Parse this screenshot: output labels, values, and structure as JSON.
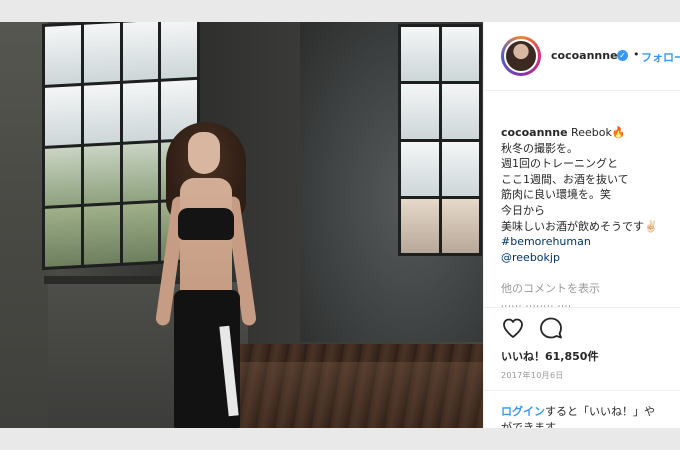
{
  "post": {
    "username": "cocoannne",
    "verified_icon": "check-icon",
    "separator": "•",
    "follow_label": "フォロー"
  },
  "caption": {
    "author": "cocoannne",
    "first": "Reebok🔥",
    "lines": [
      "秋冬の撮影を。",
      "週1回のトレーニングと",
      "ここ1週間、お酒を抜いて",
      "筋肉に良い環境を。笑",
      "今日から",
      "美味しいお酒が飲めそうです✌🏻"
    ],
    "hashtag": "#bemorehuman",
    "mention": "@reebokjp"
  },
  "comments": {
    "view_more": "他のコメントを表示"
  },
  "actions": {
    "like_icon": "heart-icon",
    "comment_icon": "comment-icon"
  },
  "likes_text": "いいね！61,850件",
  "date_text": "2017年10月6日",
  "login": {
    "link": "ログイン",
    "rest1": "すると「いいね！」や",
    "rest2": "ができます。"
  },
  "colors": {
    "accent": "#3897f0",
    "text": "#262626",
    "muted": "#999999",
    "page_bg": "#e9e9ea"
  }
}
